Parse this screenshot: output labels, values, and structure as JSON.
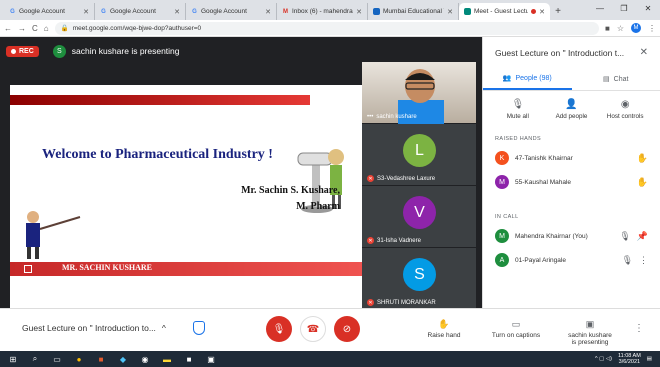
{
  "browser": {
    "tabs": [
      {
        "label": "Google Account",
        "icon": "google-g"
      },
      {
        "label": "Google Account",
        "icon": "google-g"
      },
      {
        "label": "Google Account",
        "icon": "google-g"
      },
      {
        "label": "Inbox (6) - mahendrak",
        "icon": "gmail"
      },
      {
        "label": "Mumbai Educational Tr",
        "icon": "site"
      },
      {
        "label": "Meet - Guest Lectu",
        "icon": "meet"
      }
    ],
    "new_tab": "+",
    "url": "meet.google.com/wqe-bjwe-dop?authuser=0",
    "profile_initial": "M"
  },
  "meet": {
    "rec_label": "REC",
    "presenter_initial": "S",
    "presenting_text": "sachin kushare is presenting",
    "slide": {
      "title": "Welcome to Pharmaceutical Industry !",
      "author": "Mr. Sachin S. Kushare,",
      "degree": "M. Pharm",
      "footer": "MR. SACHIN KUSHARE"
    },
    "tiles": [
      {
        "name": "sachin kushare",
        "initial": "",
        "color": "",
        "video": true
      },
      {
        "name": "S3-Vedashree Laxure",
        "initial": "L",
        "color": "#7cb342",
        "video": false
      },
      {
        "name": "31-Isha Vadnere",
        "initial": "V",
        "color": "#8e24aa",
        "video": false
      },
      {
        "name": "SHRUTI MORANKAR",
        "initial": "S",
        "color": "#039be5",
        "video": false
      }
    ],
    "panel": {
      "title": "Guest Lecture on \" Introduction t...",
      "people_tab": "People (98)",
      "chat_tab": "Chat",
      "actions": [
        "Mute all",
        "Add people",
        "Host controls"
      ],
      "raised_hands_header": "RAISED HANDS",
      "raised": [
        {
          "initial": "K",
          "name": "47-Tanishk Khairnar",
          "color": "#f4511e"
        },
        {
          "initial": "M",
          "name": "55-Kaushal Mahale",
          "color": "#8e24aa"
        }
      ],
      "in_call_header": "IN CALL",
      "in_call": [
        {
          "initial": "M",
          "name": "Mahendra Khairnar (You)",
          "color": "#1e8e3e"
        },
        {
          "initial": "A",
          "name": "01-Payal Aringale",
          "color": "#1e8e3e"
        }
      ]
    },
    "bottom": {
      "meeting_name": "Guest Lecture on \" Introduction to...",
      "raise_hand": "Raise hand",
      "captions": "Turn on captions",
      "presenting_line1": "sachin kushare",
      "presenting_line2": "is presenting"
    }
  },
  "taskbar": {
    "time": "11:08 AM",
    "date": "3/6/2021"
  },
  "colors": {
    "rec_red": "#d93025",
    "meet_blue": "#1a73e8",
    "dark_bg": "#202124"
  }
}
